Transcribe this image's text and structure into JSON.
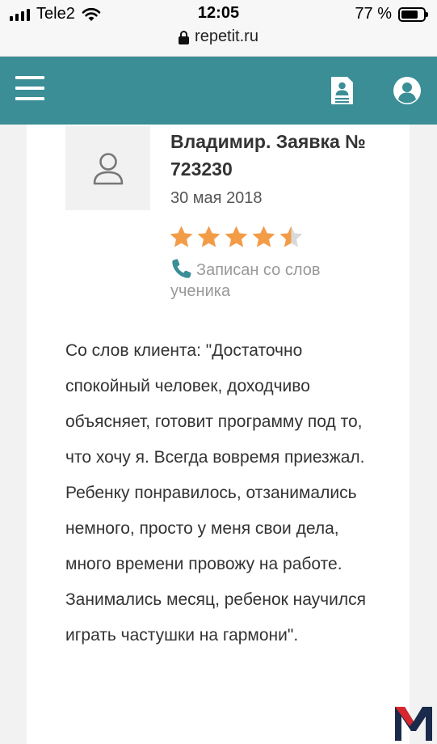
{
  "status_bar": {
    "carrier": "Tele2",
    "time": "12:05",
    "battery_percent": "77 %",
    "battery_level": 0.77,
    "signal_icon": "signal-bars-icon",
    "wifi_icon": "wifi-icon"
  },
  "url_bar": {
    "url": "repetit.ru",
    "lock_icon": "lock-icon"
  },
  "header": {
    "background_color": "#3b8e96",
    "menu_icon": "hamburger-menu-icon",
    "profile_doc_icon": "profile-document-icon",
    "user_icon": "user-account-icon"
  },
  "review": {
    "title": "Владимир. Заявка № 723230",
    "date": "30 мая 2018",
    "rating": 4.5,
    "rating_max": 5,
    "star_color": "#f39c47",
    "source_note": "Записан со слов ученика",
    "text": "Со слов клиента: \"Достаточно спокойный человек, доходчиво объясняет, готовит программу под то, что хочу я. Всегда вовремя приезжал. Ребенку понравилось, отзанимались немного, просто у меня свои дела, много времени провожу на работе. Занимались месяц, ребенок научился играть частушки на гармони\"."
  },
  "watermark": {
    "logo_text": "M"
  }
}
